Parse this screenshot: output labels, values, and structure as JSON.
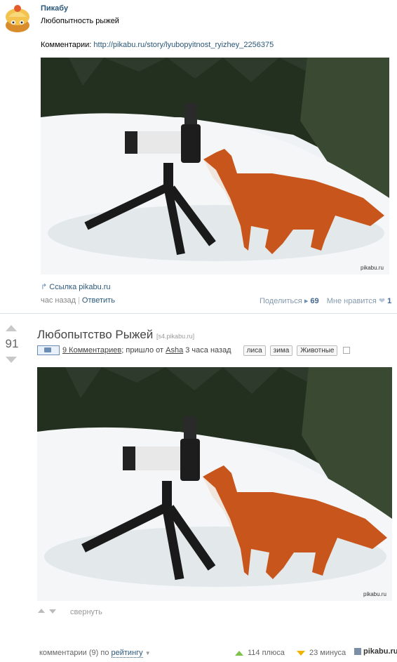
{
  "post": {
    "author": "Пикабу",
    "text": "Любопытность рыжей",
    "comments_prefix": "Комментарии: ",
    "comments_url": "http://pikabu.ru/story/lyubopyitnost_ryizhey_2256375",
    "link_label": "Ссылка pikabu.ru",
    "time": "час назад",
    "reply": "Ответить",
    "share_label": "Поделиться",
    "share_count": "69",
    "like_label": "Мне нравится",
    "like_count": "1",
    "watermark": "pikabu.ru"
  },
  "story": {
    "rating": "91",
    "title": "Любопытство Рыжей",
    "source": "[s4.pikabu.ru]",
    "comments_link": "9 Комментариев",
    "posted_from": "; пришло от ",
    "user": "Asha",
    "time": " 3 часа назад",
    "tags": [
      "лиса",
      "зима",
      "Животные"
    ],
    "collapse": "свернуть"
  },
  "footer": {
    "comments_prefix": "комментарии (9) по ",
    "sort": "рейтингу",
    "pluses": "114 плюса",
    "minuses": "23 минуса",
    "logo": "pikabu.ru"
  },
  "colors": {
    "link": "#2b587a",
    "plus": "#7cc24b",
    "minus": "#f0b400"
  }
}
